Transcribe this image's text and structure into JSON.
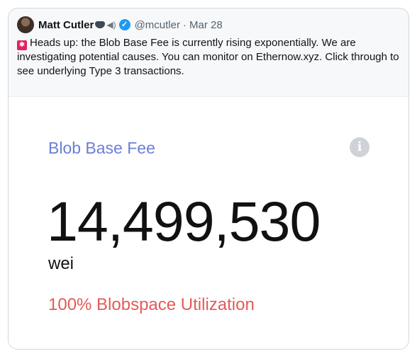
{
  "tweet": {
    "author_name": "Matt Cutler",
    "handle": "@mcutler",
    "separator": "·",
    "date": "Mar 28",
    "text": "Heads up: the Blob Base Fee is currently rising exponentially. We are investigating potential causes. You can monitor on Ethernow.xyz. Click through to see underlying Type 3 transactions."
  },
  "media": {
    "label": "Blob Base Fee",
    "value": "14,499,530",
    "unit": "wei",
    "utilization": "100% Blobspace Utilization"
  },
  "icons": {
    "avatar": "avatar",
    "verified": "verified-badge-icon",
    "siren": "siren-icon",
    "info": "info-icon"
  },
  "colors": {
    "label": "#6c7fd6",
    "utilization": "#e35a5a",
    "verified": "#1d9bf0"
  }
}
